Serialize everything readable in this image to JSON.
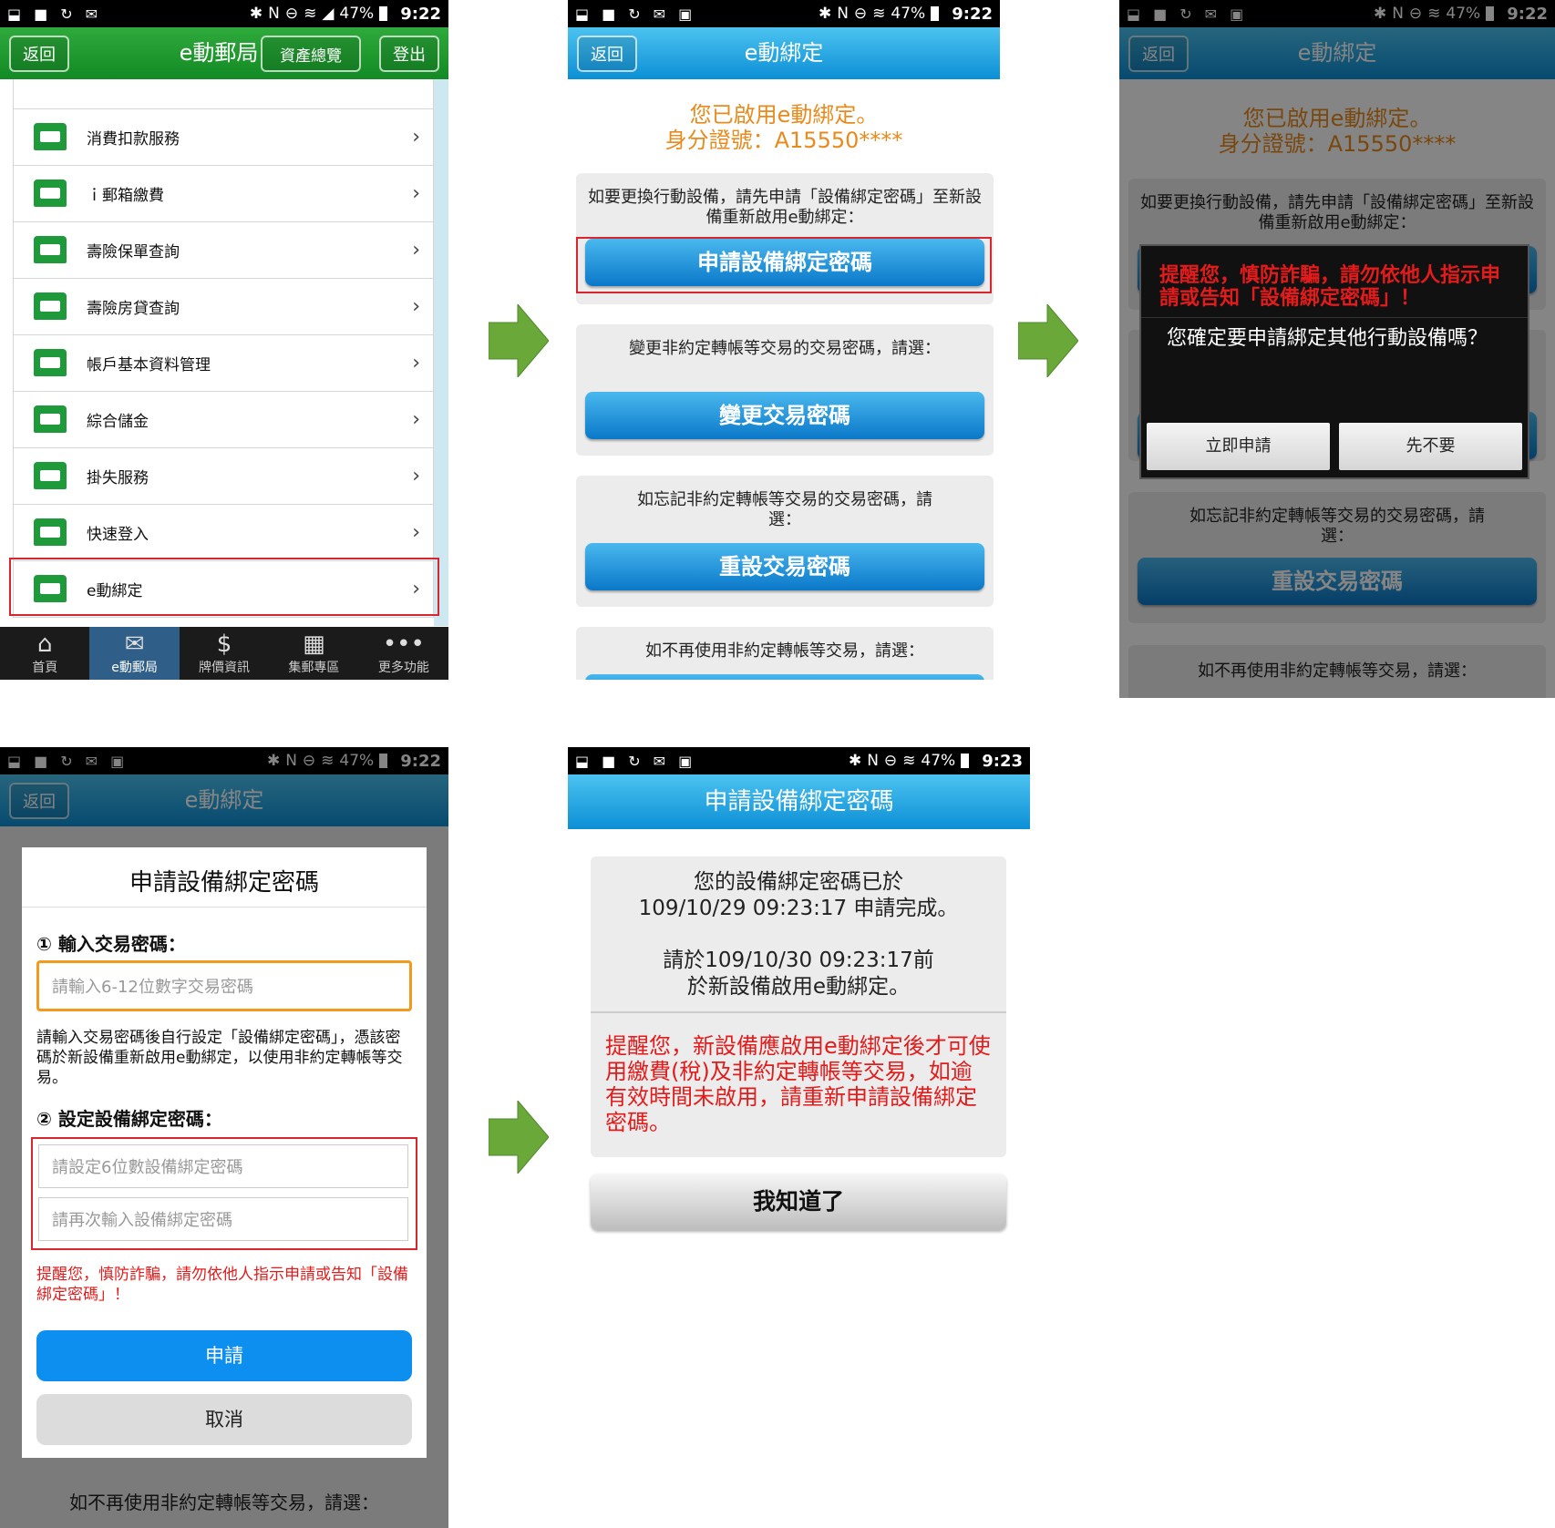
{
  "status_bar": {
    "battery": "47%",
    "time": "9:22",
    "time_last": "9:23"
  },
  "panel1": {
    "back_label": "返回",
    "title": "e動郵局",
    "assets_label": "資產總覽",
    "logout_label": "登出",
    "menu_items": [
      {
        "label": "消費扣款服務"
      },
      {
        "label": "ｉ郵箱繳費"
      },
      {
        "label": "壽險保單查詢"
      },
      {
        "label": "壽險房貸查詢"
      },
      {
        "label": "帳戶基本資料管理"
      },
      {
        "label": "綜合儲金"
      },
      {
        "label": "掛失服務"
      },
      {
        "label": "快速登入"
      },
      {
        "label": "e動綁定"
      }
    ],
    "tabs": [
      {
        "label": "首頁",
        "icon": "home-icon"
      },
      {
        "label": "e動郵局",
        "icon": "mailbox-icon"
      },
      {
        "label": "牌價資訊",
        "icon": "dollar-icon"
      },
      {
        "label": "集郵專區",
        "icon": "stamp-icon"
      },
      {
        "label": "更多功能",
        "icon": "more-icon"
      }
    ]
  },
  "panel2": {
    "back_label": "返回",
    "title": "e動綁定",
    "enabled_line": "您已啟用e動綁定。",
    "id_line": "身分證號：A15550****",
    "card1_text": "如要更換行動設備，請先申請「設備綁定密碼」至新設備重新啟用e動綁定：",
    "card1_button": "申請設備綁定密碼",
    "card2_text": "變更非約定轉帳等交易的交易密碼，請選：",
    "card2_button": "變更交易密碼",
    "card3_text": "如忘記非約定轉帳等交易的交易密碼，請選：",
    "card3_button": "重設交易密碼",
    "card4_text": "如不再使用非約定轉帳等交易，請選："
  },
  "panel3": {
    "warning": "提醒您，慎防詐騙，請勿依他人指示申請或告知「設備綁定密碼」！",
    "question": "您確定要申請綁定其他行動設備嗎？",
    "confirm_label": "立即申請",
    "decline_label": "先不要"
  },
  "panel4": {
    "dialog_title": "申請設備綁定密碼",
    "step1_label": "① 輸入交易密碼：",
    "step1_placeholder": "請輸入6-12位數字交易密碼",
    "description": "請輸入交易密碼後自行設定「設備綁定密碼」，憑該密碼於新設備重新啟用e動綁定，以使用非約定轉帳等交易。",
    "step2_label": "② 設定設備綁定密碼：",
    "step2_placeholder": "請設定6位數設備綁定密碼",
    "step2_confirm_placeholder": "請再次輸入設備綁定密碼",
    "warning": "提醒您，慎防詐騙，請勿依他人指示申請或告知「設備綁定密碼」！",
    "apply_label": "申請",
    "cancel_label": "取消",
    "bottom_text": "如不再使用非約定轉帳等交易，請選："
  },
  "panel5": {
    "title": "申請設備綁定密碼",
    "done_line1": "您的設備綁定密碼已於",
    "done_line2": "109/10/29 09:23:17 申請完成。",
    "deadline_line1": "請於109/10/30 09:23:17前",
    "deadline_line2": "於新設備啟用e動綁定。",
    "warning": "提醒您，新設備應啟用e動綁定後才可使用繳費(稅)及非約定轉帳等交易，如逾有效時間未啟用，請重新申請設備綁定密碼。",
    "ok_label": "我知道了"
  },
  "colors": {
    "green_header": "#1f9a3a",
    "blue_header": "#0c8fd6",
    "orange_text": "#e98a1c",
    "warning_red": "#e31b1b",
    "highlight_red": "#d9262e",
    "arrow_green": "#6aa83a"
  }
}
